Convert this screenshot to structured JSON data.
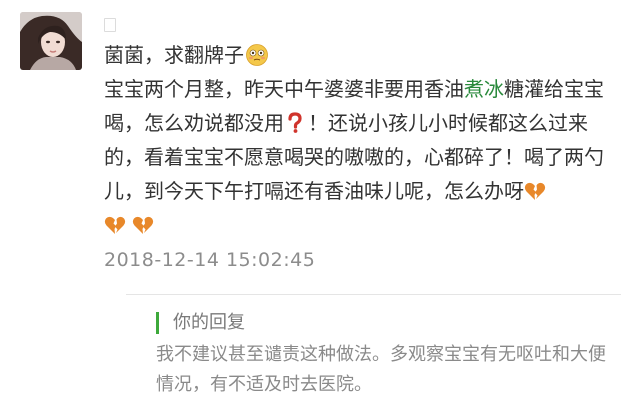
{
  "comment": {
    "username_line": "菌菌，求翻牌子",
    "text_1": "宝宝两个月整，昨天中午婆婆非要用香油",
    "highlight": "煮冰",
    "text_2": "糖灌给宝宝喝，怎么劝说都没用",
    "text_3": "！还说小孩儿小时候都这么过来的，看着宝宝不愿意喝哭的嗷嗷的，心都碎了！喝了两勺儿，到今天下午打嗝还有香油味儿呢，怎么办呀",
    "timestamp": "2018-12-14 15:02:45",
    "icons": [
      "tag-box-icon",
      "flushed-face-emoji",
      "red-question-mark-emoji",
      "broken-heart-emoji"
    ]
  },
  "reply": {
    "label": "你的回复",
    "text": "我不建议甚至谴责这种做法。多观察宝宝有无呕吐和大便情况，有不适及时去医院。"
  },
  "colors": {
    "highlight": "#2a8a3c",
    "reply_bar": "#3da93b",
    "timestamp": "#8c8c8c",
    "body_text": "#333333"
  }
}
